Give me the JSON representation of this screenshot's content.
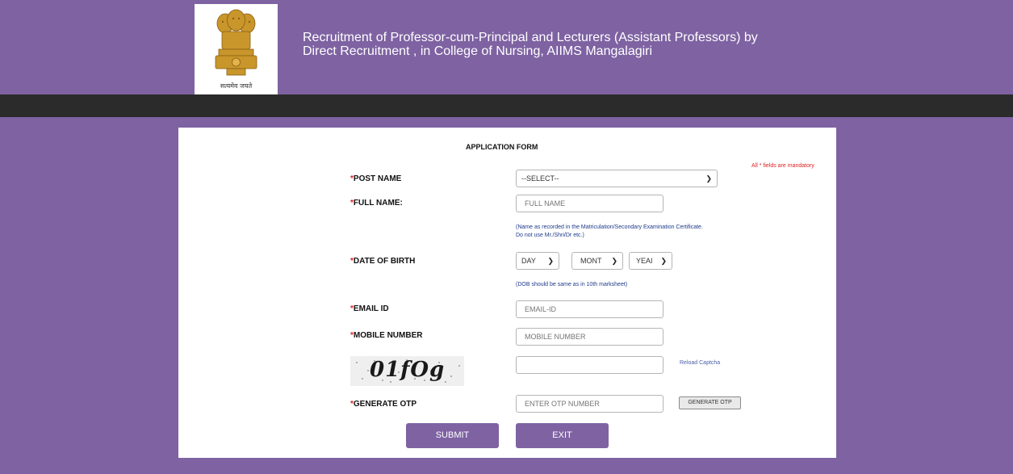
{
  "header": {
    "title_line1": "Recruitment of Professor-cum-Principal and Lecturers (Assistant Professors) by",
    "title_line2": "Direct Recruitment , in College of Nursing, AIIMS Mangalagiri",
    "emblem_caption": "सत्यमेव जयते"
  },
  "form": {
    "title": "APPLICATION FORM",
    "mandatory_note": "All * fields are mandatory",
    "star": "*",
    "post_name": {
      "label": "POST NAME",
      "selected": "--SELECT--"
    },
    "full_name": {
      "label": "FULL NAME:",
      "placeholder": "FULL NAME",
      "hint_line1": "(Name as recorded in the Matriculation/Secondary Examination Certificate.",
      "hint_line2": "Do not use Mr./Shri/Dr etc.)"
    },
    "dob": {
      "label": "DATE OF BIRTH",
      "day": "DAY",
      "month": "MONT",
      "year": "YEAI",
      "hint": "(DOB should be same as in 10th marksheet)"
    },
    "email": {
      "label": "EMAIL ID",
      "placeholder": "EMAIL-ID"
    },
    "mobile": {
      "label": "MOBILE NUMBER",
      "placeholder": "MOBILE NUMBER"
    },
    "captcha": {
      "text": "01fOg",
      "reload_label": "Reload Captcha"
    },
    "otp": {
      "label": "GENERATE OTP",
      "placeholder": "ENTER OTP NUMBER",
      "button": "GENERATE OTP"
    },
    "submit": "SUBMIT",
    "exit": "EXIT"
  },
  "colors": {
    "brand": "#7e62a2",
    "dark_bar": "#2b2b2b",
    "required": "#e02020",
    "hint": "#1e3a8a"
  },
  "icons": [
    "national-emblem-icon",
    "chevron-down-icon"
  ]
}
